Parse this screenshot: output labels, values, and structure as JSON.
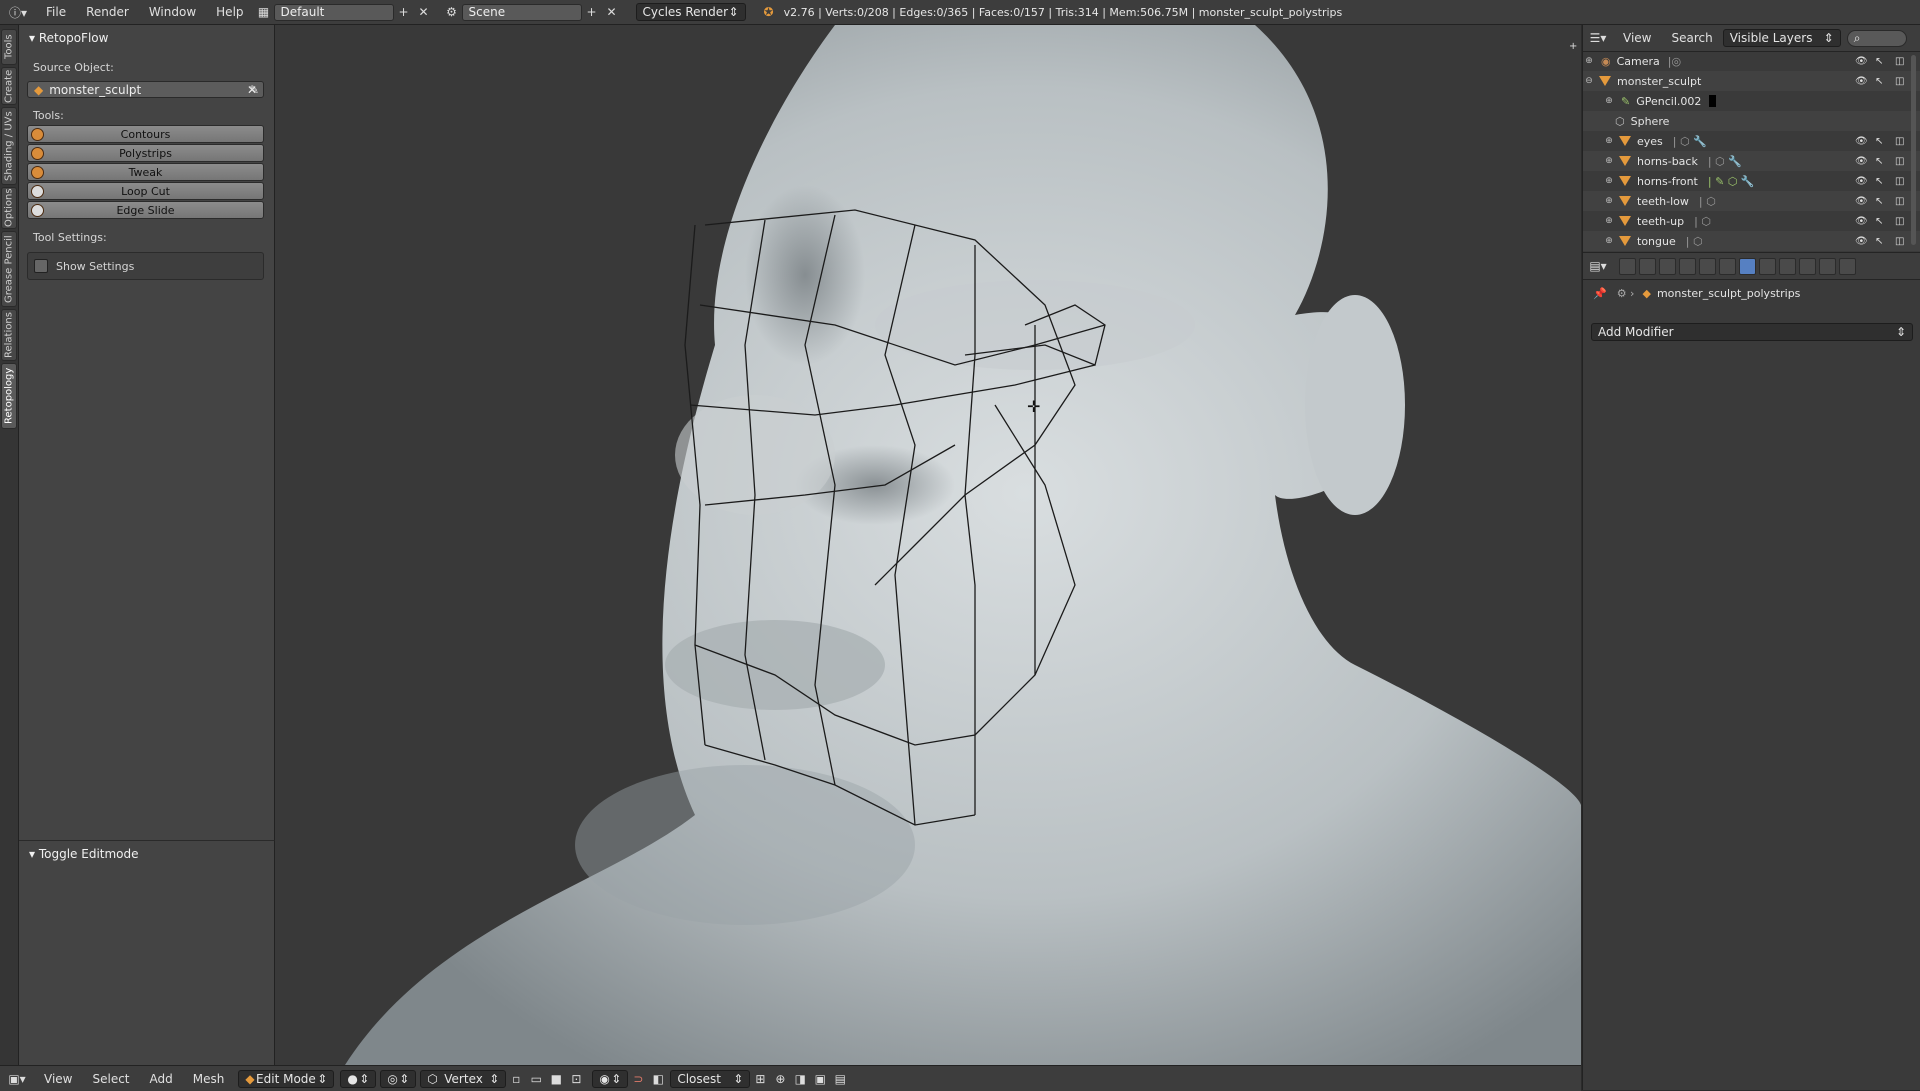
{
  "topbar": {
    "menu": [
      "File",
      "Render",
      "Window",
      "Help"
    ],
    "layout": "Default",
    "scene": "Scene",
    "engine": "Cycles Render",
    "stats": "v2.76 | Verts:0/208 | Edges:0/365 | Faces:0/157 | Tris:314 | Mem:506.75M | monster_sculpt_polystrips"
  },
  "vtabs": [
    "Tools",
    "Create",
    "Shading / UVs",
    "Options",
    "Grease Pencil",
    "Relations",
    "Retopology"
  ],
  "toolpanel": {
    "title": "RetopoFlow",
    "source_label": "Source Object:",
    "source_value": "monster_sculpt",
    "tools_label": "Tools:",
    "tools": [
      "Contours",
      "Polystrips",
      "Tweak",
      "Loop Cut",
      "Edge Slide"
    ],
    "settings_label": "Tool Settings:",
    "show_settings": "Show Settings"
  },
  "redo_panel": {
    "title": "Toggle Editmode"
  },
  "bottombar": {
    "menu": [
      "View",
      "Select",
      "Add",
      "Mesh"
    ],
    "mode": "Edit Mode",
    "pivot": "Vertex",
    "snap": "Closest"
  },
  "outliner": {
    "view": "View",
    "search": "Search",
    "filter": "Visible Layers",
    "items": [
      "Camera",
      "monster_sculpt",
      "GPencil.002",
      "Sphere",
      "eyes",
      "horns-back",
      "horns-front",
      "teeth-low",
      "teeth-up",
      "tongue"
    ]
  },
  "properties": {
    "object_name": "monster_sculpt_polystrips",
    "add_modifier": "Add Modifier"
  },
  "colors": {
    "accent": "#5680c2",
    "object_orange": "#e59a3c"
  }
}
